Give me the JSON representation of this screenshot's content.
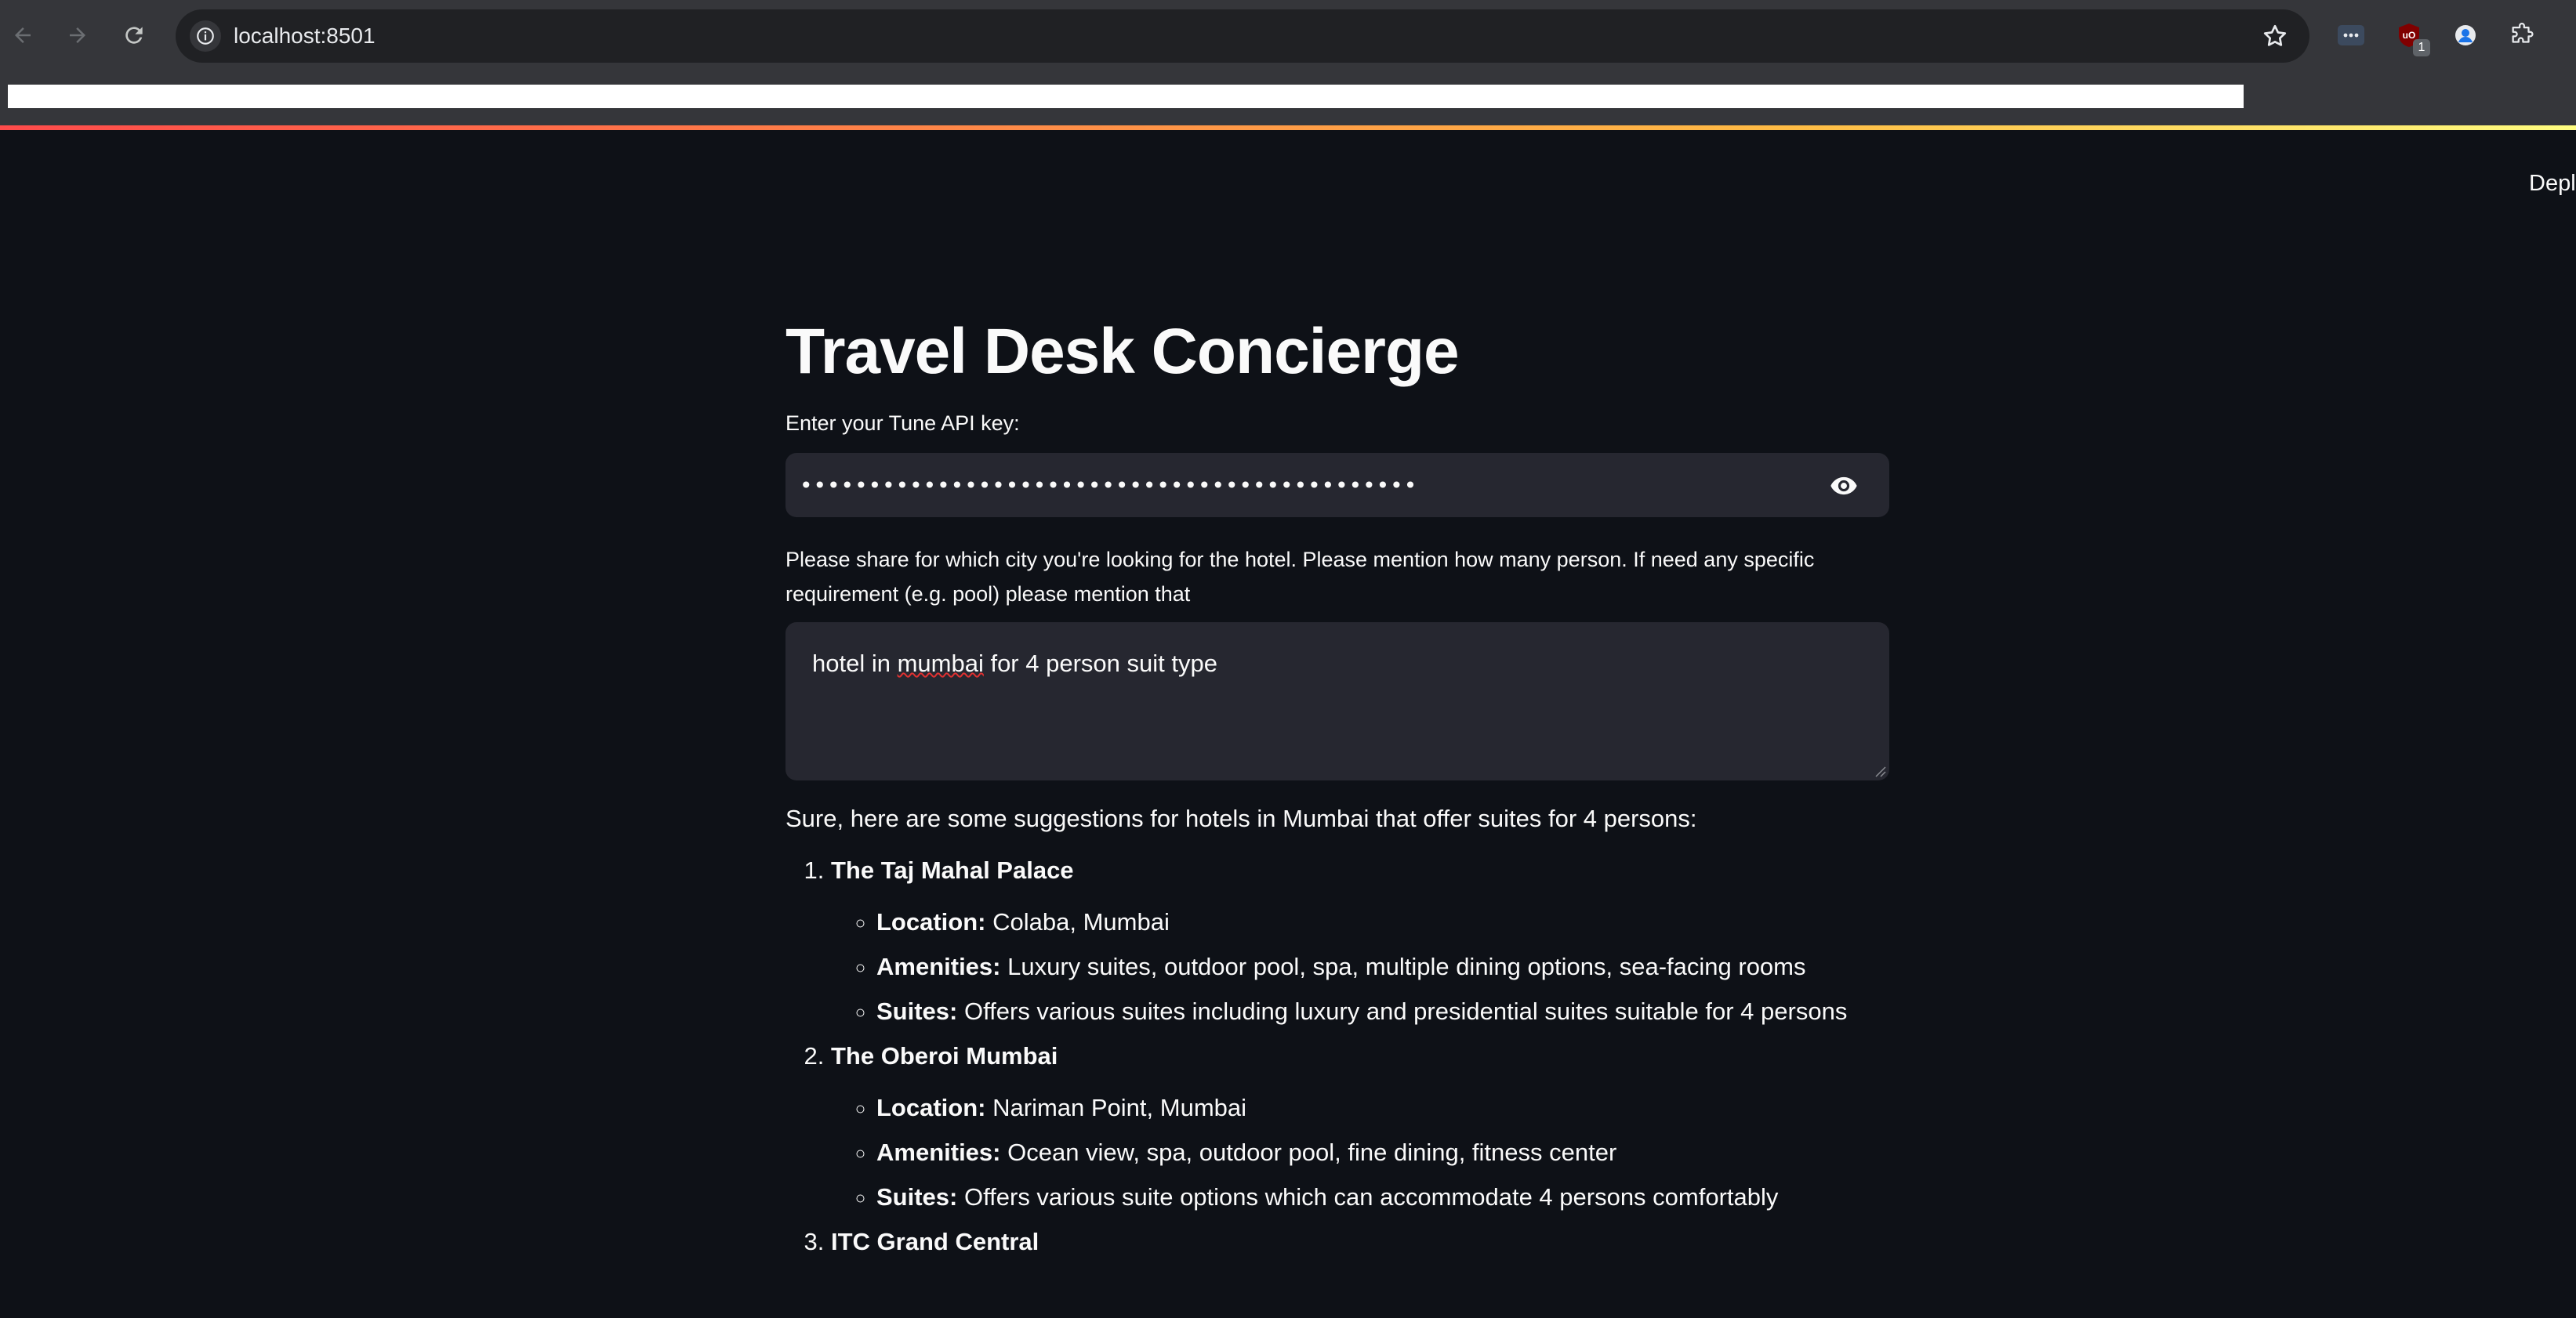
{
  "browser": {
    "url": "localhost:8501",
    "extension_badge": "1"
  },
  "app": {
    "deploy_label": "Deploy",
    "title": "Travel Desk Concierge",
    "api_key_label": "Enter your Tune API key:",
    "api_key_value": "•••••••••••••••••••••••••••••••••••••••••••••",
    "prompt_label": "Please share for which city you're looking for the hotel. Please mention how many person. If need any specific requirement (e.g. pool) please mention that",
    "query": {
      "before": "hotel in ",
      "misspelled": "mumbai",
      "after": " for 4 person suit type"
    }
  },
  "response": {
    "intro": "Sure, here are some suggestions for hotels in Mumbai that offer suites for 4 persons:",
    "hotels": [
      {
        "name": "The Taj Mahal Palace",
        "details": [
          {
            "key": "Location:",
            "value": " Colaba, Mumbai"
          },
          {
            "key": "Amenities:",
            "value": " Luxury suites, outdoor pool, spa, multiple dining options, sea-facing rooms"
          },
          {
            "key": "Suites:",
            "value": " Offers various suites including luxury and presidential suites suitable for 4 persons"
          }
        ]
      },
      {
        "name": "The Oberoi Mumbai",
        "details": [
          {
            "key": "Location:",
            "value": " Nariman Point, Mumbai"
          },
          {
            "key": "Amenities:",
            "value": " Ocean view, spa, outdoor pool, fine dining, fitness center"
          },
          {
            "key": "Suites:",
            "value": " Offers various suite options which can accommodate 4 persons comfortably"
          }
        ]
      },
      {
        "name": "ITC Grand Central",
        "details": []
      }
    ]
  },
  "colors": {
    "app_background": "#0e1117",
    "widget_background": "#262730",
    "text": "#fafafa",
    "browser_toolbar": "#35363a"
  }
}
